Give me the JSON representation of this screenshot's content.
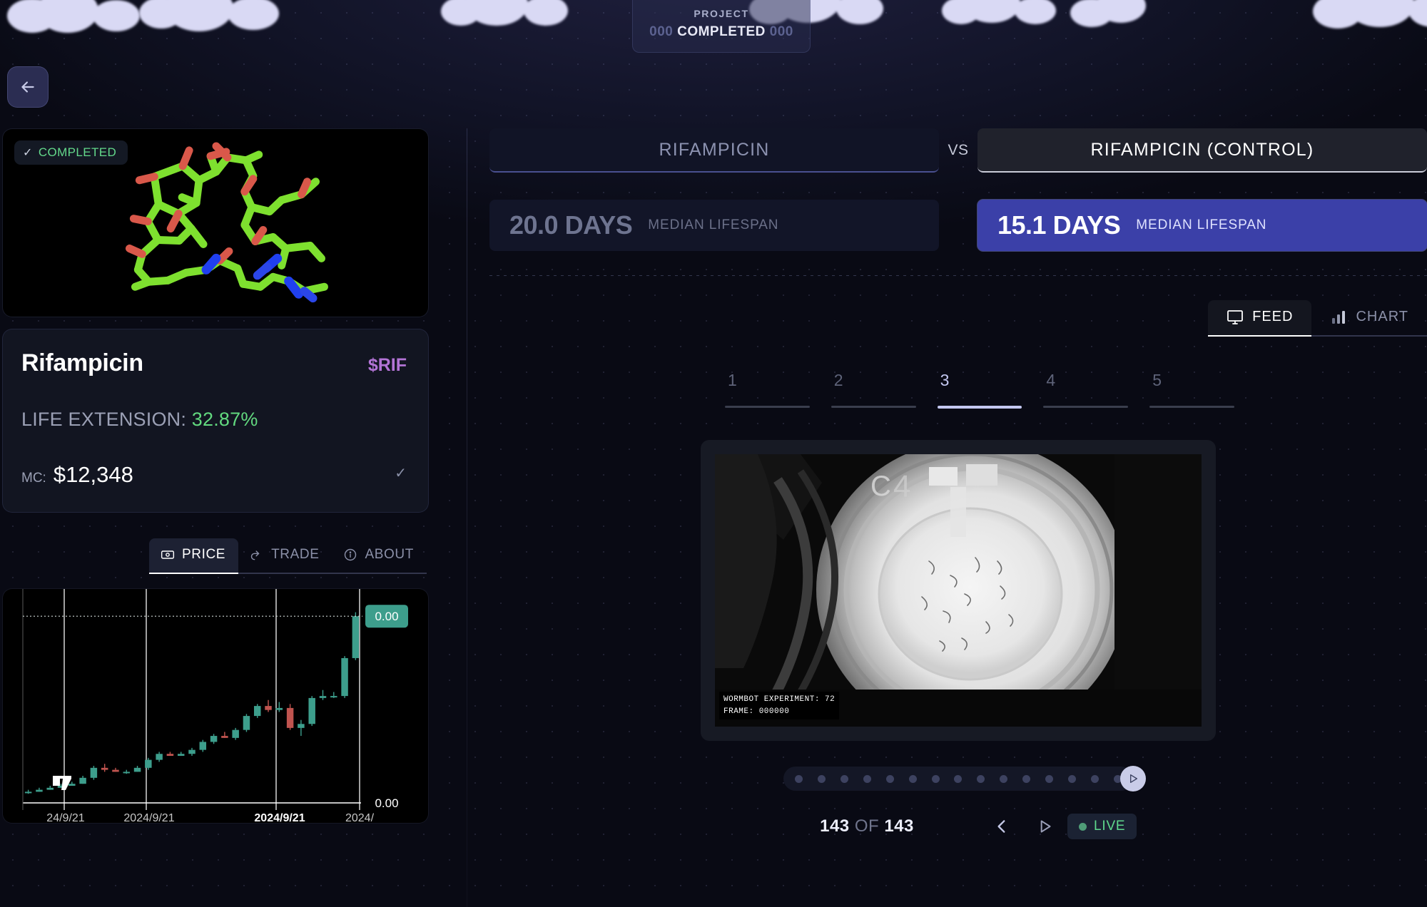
{
  "header": {
    "badge_title": "PROJECT",
    "badge_zeros_left": "000",
    "badge_text": "COMPLETED",
    "badge_zeros_right": "000",
    "back_icon": "arrow-left-icon"
  },
  "molecule_card": {
    "status_check": "✓",
    "status_label": "COMPLETED"
  },
  "info": {
    "drug_name": "Rifampicin",
    "ticker": "$RIF",
    "life_extension_label": "LIFE EXTENSION:",
    "life_extension_value": "32.87%",
    "mc_label": "MC:",
    "mc_value": "$12,348",
    "verified_check": "✓",
    "accent_green": "#62d97f",
    "accent_purple": "#b374d6"
  },
  "left_tabs": [
    {
      "label": "PRICE",
      "icon": "money-icon",
      "active": true
    },
    {
      "label": "TRADE",
      "icon": "trade-arrow-icon",
      "active": false
    },
    {
      "label": "ABOUT",
      "icon": "info-icon",
      "active": false
    }
  ],
  "comparison": {
    "left_name": "RIFAMPICIN",
    "vs_label": "VS",
    "right_name": "RIFAMPICIN (CONTROL)",
    "left_stat_value": "20.0 DAYS",
    "left_stat_label": "MEDIAN LIFESPAN",
    "right_stat_value": "15.1 DAYS",
    "right_stat_label": "MEDIAN LIFESPAN",
    "highlight_color": "#3b40a8"
  },
  "view_tabs": [
    {
      "label": "FEED",
      "icon": "monitor-icon",
      "active": true
    },
    {
      "label": "CHART",
      "icon": "bar-chart-icon",
      "active": false
    }
  ],
  "steps": [
    {
      "n": "1",
      "active": false
    },
    {
      "n": "2",
      "active": false
    },
    {
      "n": "3",
      "active": true
    },
    {
      "n": "4",
      "active": false
    },
    {
      "n": "5",
      "active": false
    }
  ],
  "video": {
    "osd_line1": "WORMBOT EXPERIMENT: 72",
    "osd_line2": "FRAME: 000000"
  },
  "playback": {
    "dot_count": 15,
    "play_icon": "play-icon",
    "counter_current": "143",
    "counter_of": "OF",
    "counter_total": "143",
    "prev_icon": "chevron-left-icon",
    "play_btn_icon": "play-triangle-icon",
    "next_icon": "chevron-right-icon",
    "live_label": "LIVE",
    "live_color": "#5fd98c"
  },
  "chart_data": {
    "type": "line",
    "title": "",
    "subtype": "candlestick",
    "provider_watermark": "TradingView",
    "price_badge": "0.00",
    "axis_label_bottom_right": "0.00",
    "xlabel": "",
    "ylabel": "",
    "x_tick_labels": [
      "24/9/21",
      "2024/9/21",
      "2024/9/21",
      "2024/"
    ],
    "up_color": "#3d9e8c",
    "down_color": "#c0544f",
    "candles": [
      {
        "o": 2,
        "h": 3,
        "l": 1,
        "c": 2
      },
      {
        "o": 2,
        "h": 4,
        "l": 2,
        "c": 3
      },
      {
        "o": 3,
        "h": 5,
        "l": 3,
        "c": 4
      },
      {
        "o": 4,
        "h": 6,
        "l": 4,
        "c": 5
      },
      {
        "o": 5,
        "h": 7,
        "l": 5,
        "c": 6
      },
      {
        "o": 6,
        "h": 10,
        "l": 6,
        "c": 9
      },
      {
        "o": 9,
        "h": 15,
        "l": 8,
        "c": 14
      },
      {
        "o": 14,
        "h": 16,
        "l": 12,
        "c": 13
      },
      {
        "o": 13,
        "h": 14,
        "l": 12,
        "c": 12
      },
      {
        "o": 12,
        "h": 13,
        "l": 11,
        "c": 12
      },
      {
        "o": 12,
        "h": 15,
        "l": 12,
        "c": 14
      },
      {
        "o": 14,
        "h": 19,
        "l": 13,
        "c": 18
      },
      {
        "o": 18,
        "h": 22,
        "l": 17,
        "c": 21
      },
      {
        "o": 21,
        "h": 22,
        "l": 20,
        "c": 20
      },
      {
        "o": 20,
        "h": 22,
        "l": 20,
        "c": 21
      },
      {
        "o": 21,
        "h": 24,
        "l": 20,
        "c": 23
      },
      {
        "o": 23,
        "h": 28,
        "l": 22,
        "c": 27
      },
      {
        "o": 27,
        "h": 31,
        "l": 26,
        "c": 30
      },
      {
        "o": 30,
        "h": 32,
        "l": 29,
        "c": 29
      },
      {
        "o": 29,
        "h": 34,
        "l": 28,
        "c": 33
      },
      {
        "o": 33,
        "h": 41,
        "l": 32,
        "c": 40
      },
      {
        "o": 40,
        "h": 46,
        "l": 39,
        "c": 45
      },
      {
        "o": 45,
        "h": 48,
        "l": 42,
        "c": 43
      },
      {
        "o": 43,
        "h": 47,
        "l": 42,
        "c": 44
      },
      {
        "o": 44,
        "h": 46,
        "l": 33,
        "c": 34
      },
      {
        "o": 34,
        "h": 38,
        "l": 30,
        "c": 36
      },
      {
        "o": 36,
        "h": 50,
        "l": 35,
        "c": 49
      },
      {
        "o": 49,
        "h": 53,
        "l": 48,
        "c": 50
      },
      {
        "o": 50,
        "h": 52,
        "l": 49,
        "c": 50
      },
      {
        "o": 50,
        "h": 70,
        "l": 49,
        "c": 69
      },
      {
        "o": 69,
        "h": 92,
        "l": 68,
        "c": 90
      }
    ]
  }
}
